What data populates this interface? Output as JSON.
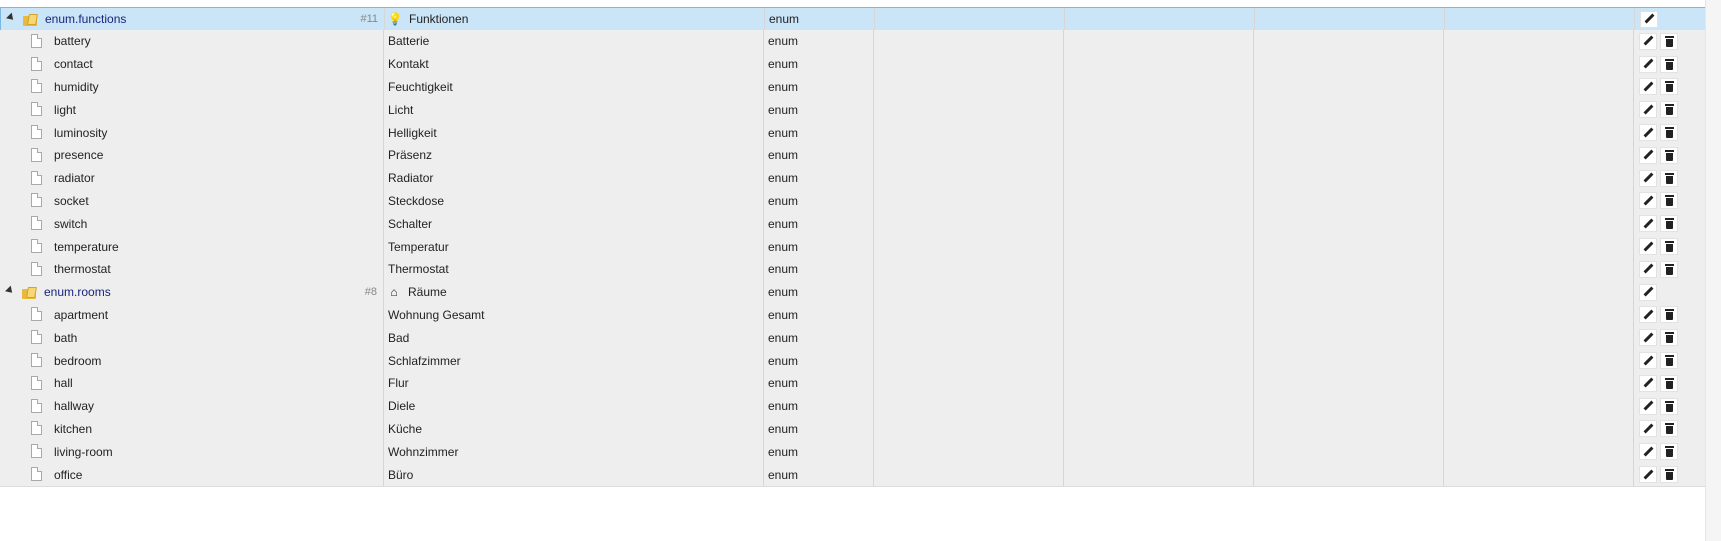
{
  "colors": {
    "row_bg": "#eeeeee",
    "selected_bg": "#c9e5f7",
    "folder_label": "#1a237e"
  },
  "groups": [
    {
      "id": "enum.functions",
      "count": "#11",
      "icon": "lightbulb-icon",
      "icon_glyph": "💡",
      "name": "Funktionen",
      "type": "enum",
      "selected": true,
      "children": [
        {
          "id": "battery",
          "name": "Batterie",
          "type": "enum"
        },
        {
          "id": "contact",
          "name": "Kontakt",
          "type": "enum"
        },
        {
          "id": "humidity",
          "name": "Feuchtigkeit",
          "type": "enum"
        },
        {
          "id": "light",
          "name": "Licht",
          "type": "enum"
        },
        {
          "id": "luminosity",
          "name": "Helligkeit",
          "type": "enum"
        },
        {
          "id": "presence",
          "name": "Präsenz",
          "type": "enum"
        },
        {
          "id": "radiator",
          "name": "Radiator",
          "type": "enum"
        },
        {
          "id": "socket",
          "name": "Steckdose",
          "type": "enum"
        },
        {
          "id": "switch",
          "name": "Schalter",
          "type": "enum"
        },
        {
          "id": "temperature",
          "name": "Temperatur",
          "type": "enum"
        },
        {
          "id": "thermostat",
          "name": "Thermostat",
          "type": "enum"
        }
      ]
    },
    {
      "id": "enum.rooms",
      "count": "#8",
      "icon": "home-icon",
      "icon_glyph": "⌂",
      "name": "Räume",
      "type": "enum",
      "selected": false,
      "children": [
        {
          "id": "apartment",
          "name": "Wohnung Gesamt",
          "type": "enum"
        },
        {
          "id": "bath",
          "name": "Bad",
          "type": "enum"
        },
        {
          "id": "bedroom",
          "name": "Schlafzimmer",
          "type": "enum"
        },
        {
          "id": "hall",
          "name": "Flur",
          "type": "enum"
        },
        {
          "id": "hallway",
          "name": "Diele",
          "type": "enum"
        },
        {
          "id": "kitchen",
          "name": "Küche",
          "type": "enum"
        },
        {
          "id": "living-room",
          "name": "Wohnzimmer",
          "type": "enum"
        },
        {
          "id": "office",
          "name": "Büro",
          "type": "enum"
        }
      ]
    }
  ]
}
